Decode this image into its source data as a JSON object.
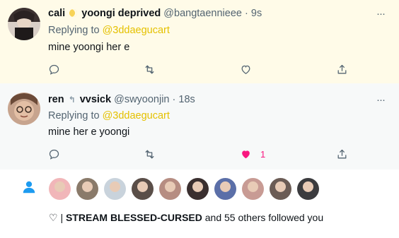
{
  "tweets": [
    {
      "name_part1": "cali",
      "name_emoji": "crescent-moon",
      "name_part2": "yoongi deprived",
      "handle": "@bangtaennieee",
      "dot": "·",
      "time": "9s",
      "replying_prefix": "Replying to",
      "replying_to": "@3ddaegucart",
      "text": "mine yoongi her e",
      "like_count": ""
    },
    {
      "name_part1": "ren",
      "name_emoji": "hand",
      "name_part2": "vvsick",
      "handle": "@swyoonjin",
      "dot": "·",
      "time": "18s",
      "replying_prefix": "Replying to",
      "replying_to": "@3ddaegucart",
      "text": "mine her e yoongi",
      "like_count": "1"
    }
  ],
  "notification": {
    "prefix": "♡ |",
    "account": "STREAM BLESSED-CURSED",
    "suffix": "and 55 others followed you",
    "avatar_colors": [
      "#f1b6b9",
      "#8a7a6a",
      "#c9d3dc",
      "#5a4e48",
      "#b68d82",
      "#3a2f2f",
      "#5b6fa8",
      "#c89b94",
      "#6b5c55",
      "#3b3b3e"
    ]
  },
  "glyphs": {
    "more": "···",
    "moon": "🌙",
    "hand": "↰"
  },
  "colors": {
    "accent_mention": "#e5c100",
    "like_pink": "#f91880",
    "follow_blue": "#1d9bf0",
    "muted": "#536471"
  }
}
